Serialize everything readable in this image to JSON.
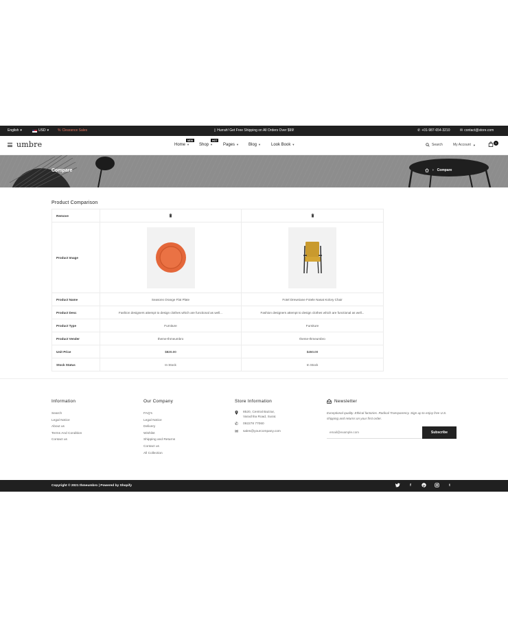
{
  "topbar": {
    "language": "English",
    "currency": "USD",
    "clearance": "Clearance Sales",
    "promo": "Hurrah! Get Free Shipping on All Orders Over $99!",
    "phone": "+01-987-654-3210",
    "email": "contact@store.com"
  },
  "header": {
    "logo": "umbre",
    "nav": [
      {
        "label": "Home",
        "badge": "NEW"
      },
      {
        "label": "Shop",
        "badge": "HOT"
      },
      {
        "label": "Pages",
        "badge": ""
      },
      {
        "label": "Blog",
        "badge": ""
      },
      {
        "label": "Look Book",
        "badge": ""
      }
    ],
    "search_label": "Search",
    "account_label": "My Account",
    "cart_count": "0"
  },
  "banner": {
    "title": "Compare",
    "breadcrumb_current": "Compare"
  },
  "compare": {
    "title": "Product Comparison",
    "labels": {
      "remove": "Remove",
      "image": "Product Image",
      "name": "Product Name",
      "desc": "Product Desc",
      "type": "Product Type",
      "vendor": "Product Vender",
      "price": "Unit Price",
      "stock": "Stock Status"
    },
    "products": [
      {
        "name": "Seasons Orange Flat Plate",
        "desc": "Fashion designers attempt to design clothes which are functional as well...",
        "type": "Furniture",
        "vendor": "theme-thmeumbro",
        "price": "$820.00",
        "stock": "In Stock"
      },
      {
        "name": "Fotel Drewniane Fotele Nasat Kolory Chair",
        "desc": "Fashion designers attempt to design clothes which are functional as well...",
        "type": "Furniture",
        "vendor": "theme-thmeumbro",
        "price": "$450.00",
        "stock": "In Stock"
      }
    ]
  },
  "footer": {
    "information": {
      "title": "Information",
      "links": [
        "Search",
        "Legal Notice",
        "About us",
        "Terms And Condition",
        "Contact us"
      ]
    },
    "company": {
      "title": "Our Company",
      "links": [
        "FAQ's",
        "Legal Notice",
        "Delivery",
        "Wishlist",
        "Shipping and Returns",
        "Contact us",
        "All Collection"
      ]
    },
    "store": {
      "title": "Store Information",
      "address_line1": "8520, Central Bazzar,",
      "address_line2": "Varachha Road, Surat.",
      "phone": "092278 77060",
      "email": "sales@yourcompany.com"
    },
    "newsletter": {
      "title": "Newsletter",
      "text": "Exceptional quality. Ethical factories. Radical Transparency. Sign up to enjoy free U.S. shipping and returns on your first order.",
      "placeholder": "email@example.com",
      "button": "Subscribe"
    },
    "copyright": "Copyright © 2021 thmeumbro | Powered by Shopify"
  },
  "colors": {
    "dark_bar": "#202020",
    "clearance": "#e2725b",
    "in_stock": "#3cb371",
    "banner": "#8d8d8d"
  }
}
